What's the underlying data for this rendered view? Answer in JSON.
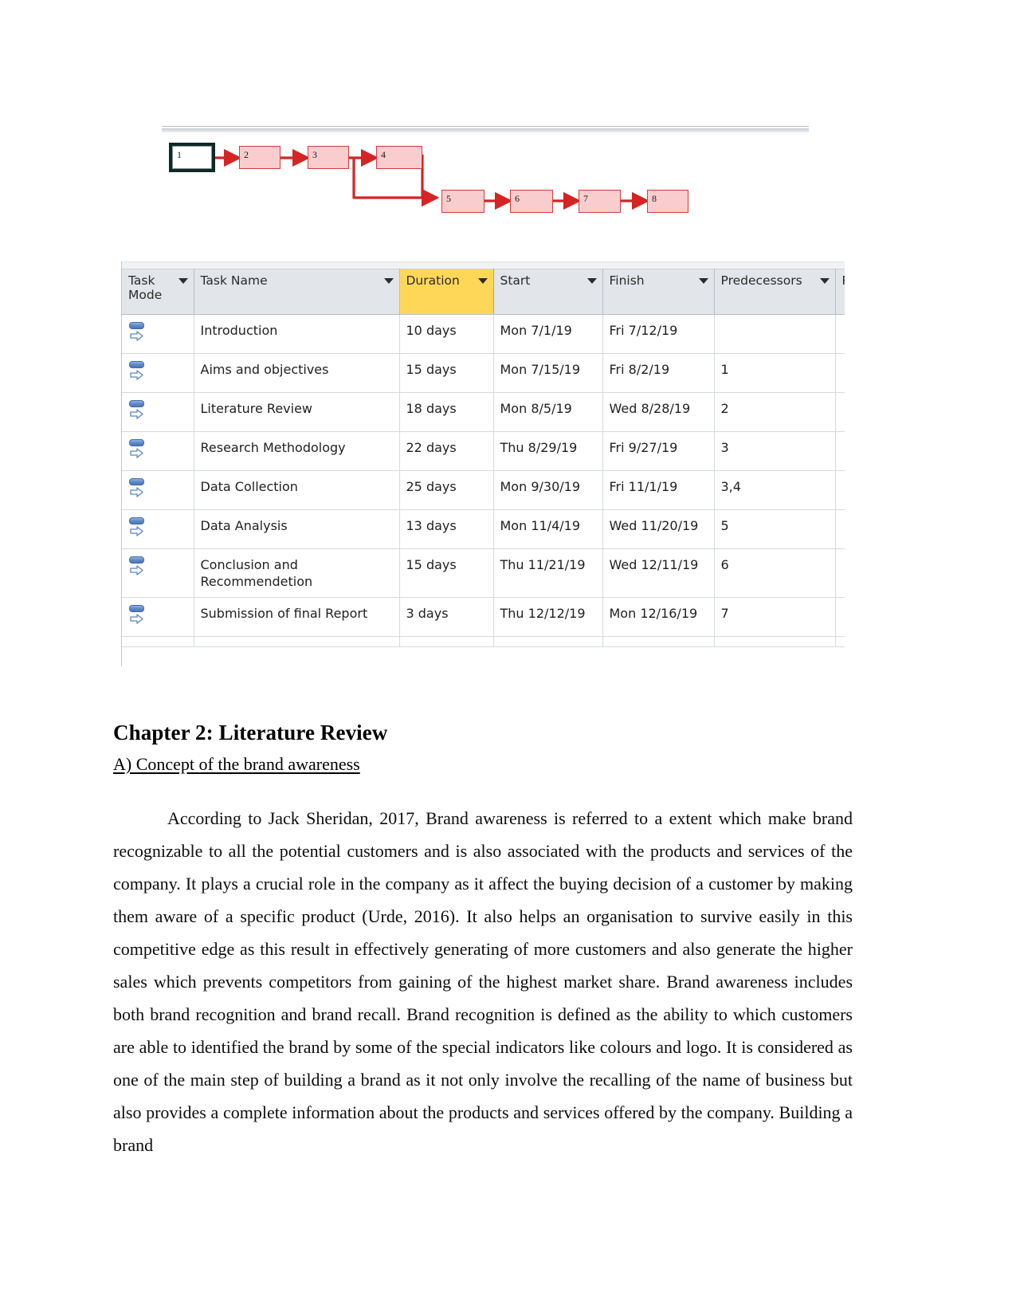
{
  "document": {
    "chapter_title": "Chapter 2: Literature Review",
    "sub_heading": "A) Concept of the brand awareness",
    "paragraph": "According to Jack Sheridan, 2017, Brand awareness is referred to a extent which make brand recognizable to all the potential customers and is also associated with the products and services of the company. It plays a crucial role in the company as it affect the buying decision of a customer by making them aware of a specific product (Urde, 2016). It also helps an organisation to survive easily in this competitive edge as this result in effectively generating of more customers and also generate the higher sales which prevents competitors from gaining of the highest market share. Brand awareness includes both brand recognition and brand recall. Brand recognition is defined as the ability to which customers are able to identified the brand by some of the special indicators like colours and logo. It is considered as one of the main step of building a brand as it not only involve the recalling of the name of business but also provides a complete information about the products and services offered by the company. Building a brand"
  },
  "network_diagram": {
    "nodes": [
      {
        "id": "1",
        "label": "1",
        "selected": true
      },
      {
        "id": "2",
        "label": "2",
        "selected": false
      },
      {
        "id": "3",
        "label": "3",
        "selected": false
      },
      {
        "id": "4",
        "label": "4",
        "selected": false
      },
      {
        "id": "5",
        "label": "5",
        "selected": false
      },
      {
        "id": "6",
        "label": "6",
        "selected": false
      },
      {
        "id": "7",
        "label": "7",
        "selected": false
      },
      {
        "id": "8",
        "label": "8",
        "selected": false
      }
    ],
    "links": [
      "1->2",
      "2->3",
      "3->4",
      "3->5",
      "4->5",
      "5->6",
      "6->7",
      "7->8"
    ],
    "colors": {
      "box_fill": "#f9cdcd",
      "box_border": "#d63b3b",
      "link": "#d42424"
    }
  },
  "project_table": {
    "columns": [
      {
        "key": "mode",
        "label": "Task Mode",
        "filter": true,
        "highlight": false
      },
      {
        "key": "name",
        "label": "Task Name",
        "filter": true,
        "highlight": false
      },
      {
        "key": "duration",
        "label": "Duration",
        "filter": true,
        "highlight": true
      },
      {
        "key": "start",
        "label": "Start",
        "filter": true,
        "highlight": false
      },
      {
        "key": "finish",
        "label": "Finish",
        "filter": true,
        "highlight": false
      },
      {
        "key": "predecessors",
        "label": "Predecessors",
        "filter": true,
        "highlight": false
      },
      {
        "key": "resource",
        "label": "R",
        "filter": false,
        "highlight": false
      }
    ],
    "highlight_color": "#ffd758",
    "rows": [
      {
        "mode_icon": "auto-schedule-icon",
        "name": "Introduction",
        "duration": "10 days",
        "start": "Mon 7/1/19",
        "finish": "Fri 7/12/19",
        "predecessors": ""
      },
      {
        "mode_icon": "auto-schedule-icon",
        "name": "Aims and objectives",
        "duration": "15 days",
        "start": "Mon 7/15/19",
        "finish": "Fri 8/2/19",
        "predecessors": "1"
      },
      {
        "mode_icon": "auto-schedule-icon",
        "name": "Literature Review",
        "duration": "18 days",
        "start": "Mon 8/5/19",
        "finish": "Wed 8/28/19",
        "predecessors": "2"
      },
      {
        "mode_icon": "auto-schedule-icon",
        "name": "Research Methodology",
        "duration": "22 days",
        "start": "Thu 8/29/19",
        "finish": "Fri 9/27/19",
        "predecessors": "3"
      },
      {
        "mode_icon": "auto-schedule-icon",
        "name": "Data Collection",
        "duration": "25 days",
        "start": "Mon 9/30/19",
        "finish": "Fri 11/1/19",
        "predecessors": "3,4"
      },
      {
        "mode_icon": "auto-schedule-icon",
        "name": "Data Analysis",
        "duration": "13 days",
        "start": "Mon 11/4/19",
        "finish": "Wed 11/20/19",
        "predecessors": "5"
      },
      {
        "mode_icon": "auto-schedule-icon",
        "name": "Conclusion and Recommendetion",
        "duration": "15 days",
        "start": "Thu 11/21/19",
        "finish": "Wed 12/11/19",
        "predecessors": "6"
      },
      {
        "mode_icon": "auto-schedule-icon",
        "name": "Submission of final Report",
        "duration": "3 days",
        "start": "Thu 12/12/19",
        "finish": "Mon 12/16/19",
        "predecessors": "7"
      }
    ]
  }
}
